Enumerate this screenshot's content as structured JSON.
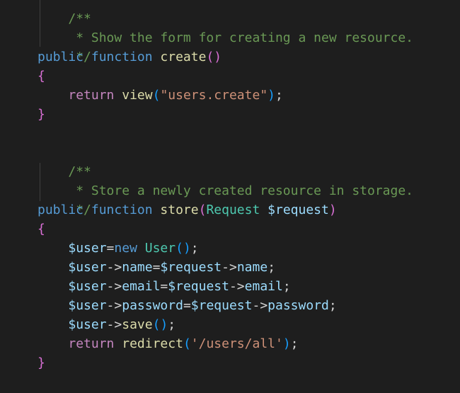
{
  "code": {
    "top_partial": "/**",
    "comment_create": " * Show the form for creating a new resource.",
    "comment_end": " */",
    "kw_public": "public",
    "kw_function": "function",
    "fn_create": "create",
    "paren_open": "(",
    "paren_close": ")",
    "brace_open": "{",
    "brace_close": "}",
    "kw_return": "return",
    "fn_view": "view",
    "str_view": "\"users.create\"",
    "semicolon": ";",
    "comment_start": "/**",
    "comment_store": " * Store a newly created resource in storage.",
    "fn_store": "store",
    "type_request": "Request",
    "var_request": "$request",
    "var_user": "$user",
    "op_assign": "=",
    "kw_new": "new",
    "type_user": "User",
    "op_arrow": "->",
    "prop_name": "name",
    "prop_email": "email",
    "prop_password": "password",
    "fn_save": "save",
    "fn_redirect": "redirect",
    "str_redirect": "'/users/all'"
  }
}
